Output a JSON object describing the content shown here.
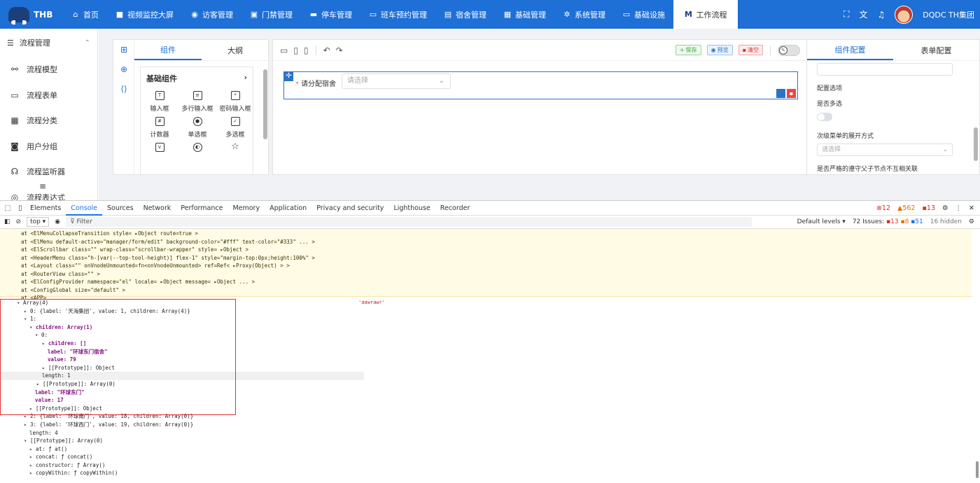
{
  "topbar": {
    "brand": "THB",
    "nav": [
      {
        "icon": "home-icon",
        "glyph": "⌂",
        "label": "首页"
      },
      {
        "icon": "video-icon",
        "glyph": "■",
        "label": "视频监控大屏"
      },
      {
        "icon": "location-icon",
        "glyph": "◉",
        "label": "访客管理"
      },
      {
        "icon": "door-icon",
        "glyph": "▣",
        "label": "门禁管理"
      },
      {
        "icon": "car-icon",
        "glyph": "▬",
        "label": "停车管理"
      },
      {
        "icon": "bus-icon",
        "glyph": "▭",
        "label": "班车预约管理"
      },
      {
        "icon": "dorm-icon",
        "glyph": "▤",
        "label": "宿舍管理"
      },
      {
        "icon": "calendar-icon",
        "glyph": "▦",
        "label": "基础管理"
      },
      {
        "icon": "gear-icon",
        "glyph": "✲",
        "label": "系统管理"
      },
      {
        "icon": "monitor-icon",
        "glyph": "▭",
        "label": "基础设施"
      },
      {
        "icon": "workflow-icon",
        "glyph": "M",
        "label": "工作流程"
      }
    ],
    "username": "DQDC TH集团"
  },
  "sidebar": {
    "header": "流程管理",
    "items": [
      {
        "icon": "model-icon",
        "glyph": "⚯",
        "label": "流程模型"
      },
      {
        "icon": "form-icon",
        "glyph": "▭",
        "label": "流程表单"
      },
      {
        "icon": "category-icon",
        "glyph": "▦",
        "label": "流程分类"
      },
      {
        "icon": "user-group-icon",
        "glyph": "◙",
        "label": "用户分组"
      },
      {
        "icon": "listener-icon",
        "glyph": "☊",
        "label": "流程监听器"
      },
      {
        "icon": "expression-icon",
        "glyph": "◎",
        "label": "流程表达式"
      }
    ]
  },
  "designer": {
    "left_tabs": [
      "组件",
      "大纲"
    ],
    "group_title": "基础组件",
    "components": [
      {
        "icon": "input-icon",
        "glyph": "T",
        "label": "输入框"
      },
      {
        "icon": "textarea-icon",
        "glyph": "≡",
        "label": "多行输入框"
      },
      {
        "icon": "password-icon",
        "glyph": "*",
        "label": "密码输入框"
      },
      {
        "icon": "counter-icon",
        "glyph": "#",
        "label": "计数器"
      },
      {
        "icon": "radio-icon",
        "glyph": "●",
        "label": "单选框"
      },
      {
        "icon": "checkbox-icon",
        "glyph": "✓",
        "label": "多选框"
      },
      {
        "icon": "select-icon",
        "glyph": "v",
        "label": ""
      },
      {
        "icon": "switch-icon",
        "glyph": "◐",
        "label": ""
      },
      {
        "icon": "star-icon",
        "glyph": "☆",
        "label": ""
      }
    ],
    "toolbar": {
      "save": "保存",
      "preview": "预览",
      "clear": "清空"
    },
    "field": {
      "label": "请分配宿舍",
      "placeholder": "请选择"
    },
    "right_tabs": [
      "组件配置",
      "表单配置"
    ],
    "config": {
      "options_label": "配置选项",
      "multiple_label": "是否多选",
      "expand_label": "次级菜单的展开方式",
      "expand_placeholder": "请选择",
      "strict_label": "是否严格的遵守父子节点不互相关联"
    }
  },
  "devtools": {
    "tabs": [
      "Elements",
      "Console",
      "Sources",
      "Network",
      "Performance",
      "Memory",
      "Application",
      "Privacy and security",
      "Lighthouse",
      "Recorder"
    ],
    "active_tab": "Console",
    "errors": "12",
    "warnings": "562",
    "infos": "13",
    "context": "top ▾",
    "filter_placeholder": "Filter",
    "levels": "Default levels ▾",
    "issues": "72 Issues:",
    "issue_err": "13",
    "issue_warn": "8",
    "issue_info": "51",
    "hidden": "16 hidden",
    "warn_lines": [
      "at <ElMenuCollapseTransition style=  ▸Object  route=true >",
      "at <ElMenu default-active=\"manager/form/edit\" background-color=\"#fff\" text-color=\"#333\"  ... >",
      "at <ElScrollbar class=\"\" wrap-class=\"scrollbar-wrapper\" style=  ▸Object >",
      "at <HeaderMenu class=\"h-[var(--top-tool-height)] flex-1\" style=\"margin-top:0px;height:100%\" >",
      "at <Layout class=\"\" onVnodeUnmounted=fn<onVnodeUnmounted> ref=Ref<  ▸Proxy(Object) > >",
      "at <RouterView class=\"\" >",
      "at <ElConfigProvider namespace=\"el\" locale=  ▸Object  message=  ▸Object  ... >",
      "at <ConfigGlobal size=\"default\" >",
      "at <APP>"
    ],
    "center_text": "'aawrawr'",
    "tree": [
      "Array(4)",
      "0: {label: '天海集团', value: 1, children: Array(4)}",
      "1:",
      "children: Array(1)",
      "0:",
      "children: []",
      "label: \"环球东门宿舍\"",
      "value: 79",
      "[[Prototype]]: Object",
      "length: 1",
      "[[Prototype]]: Array(0)",
      "label: \"环球东门\"",
      "value: 17",
      "[[Prototype]]: Object",
      "2: {label: '环球南门', value: 18, children: Array(0)}",
      "3: {label: '环球西门', value: 19, children: Array(0)}",
      "length: 4",
      "[[Prototype]]: Array(0)",
      "at: ƒ at()",
      "concat: ƒ concat()",
      "constructor: ƒ Array()",
      "copyWithin: ƒ copyWithin()"
    ]
  }
}
